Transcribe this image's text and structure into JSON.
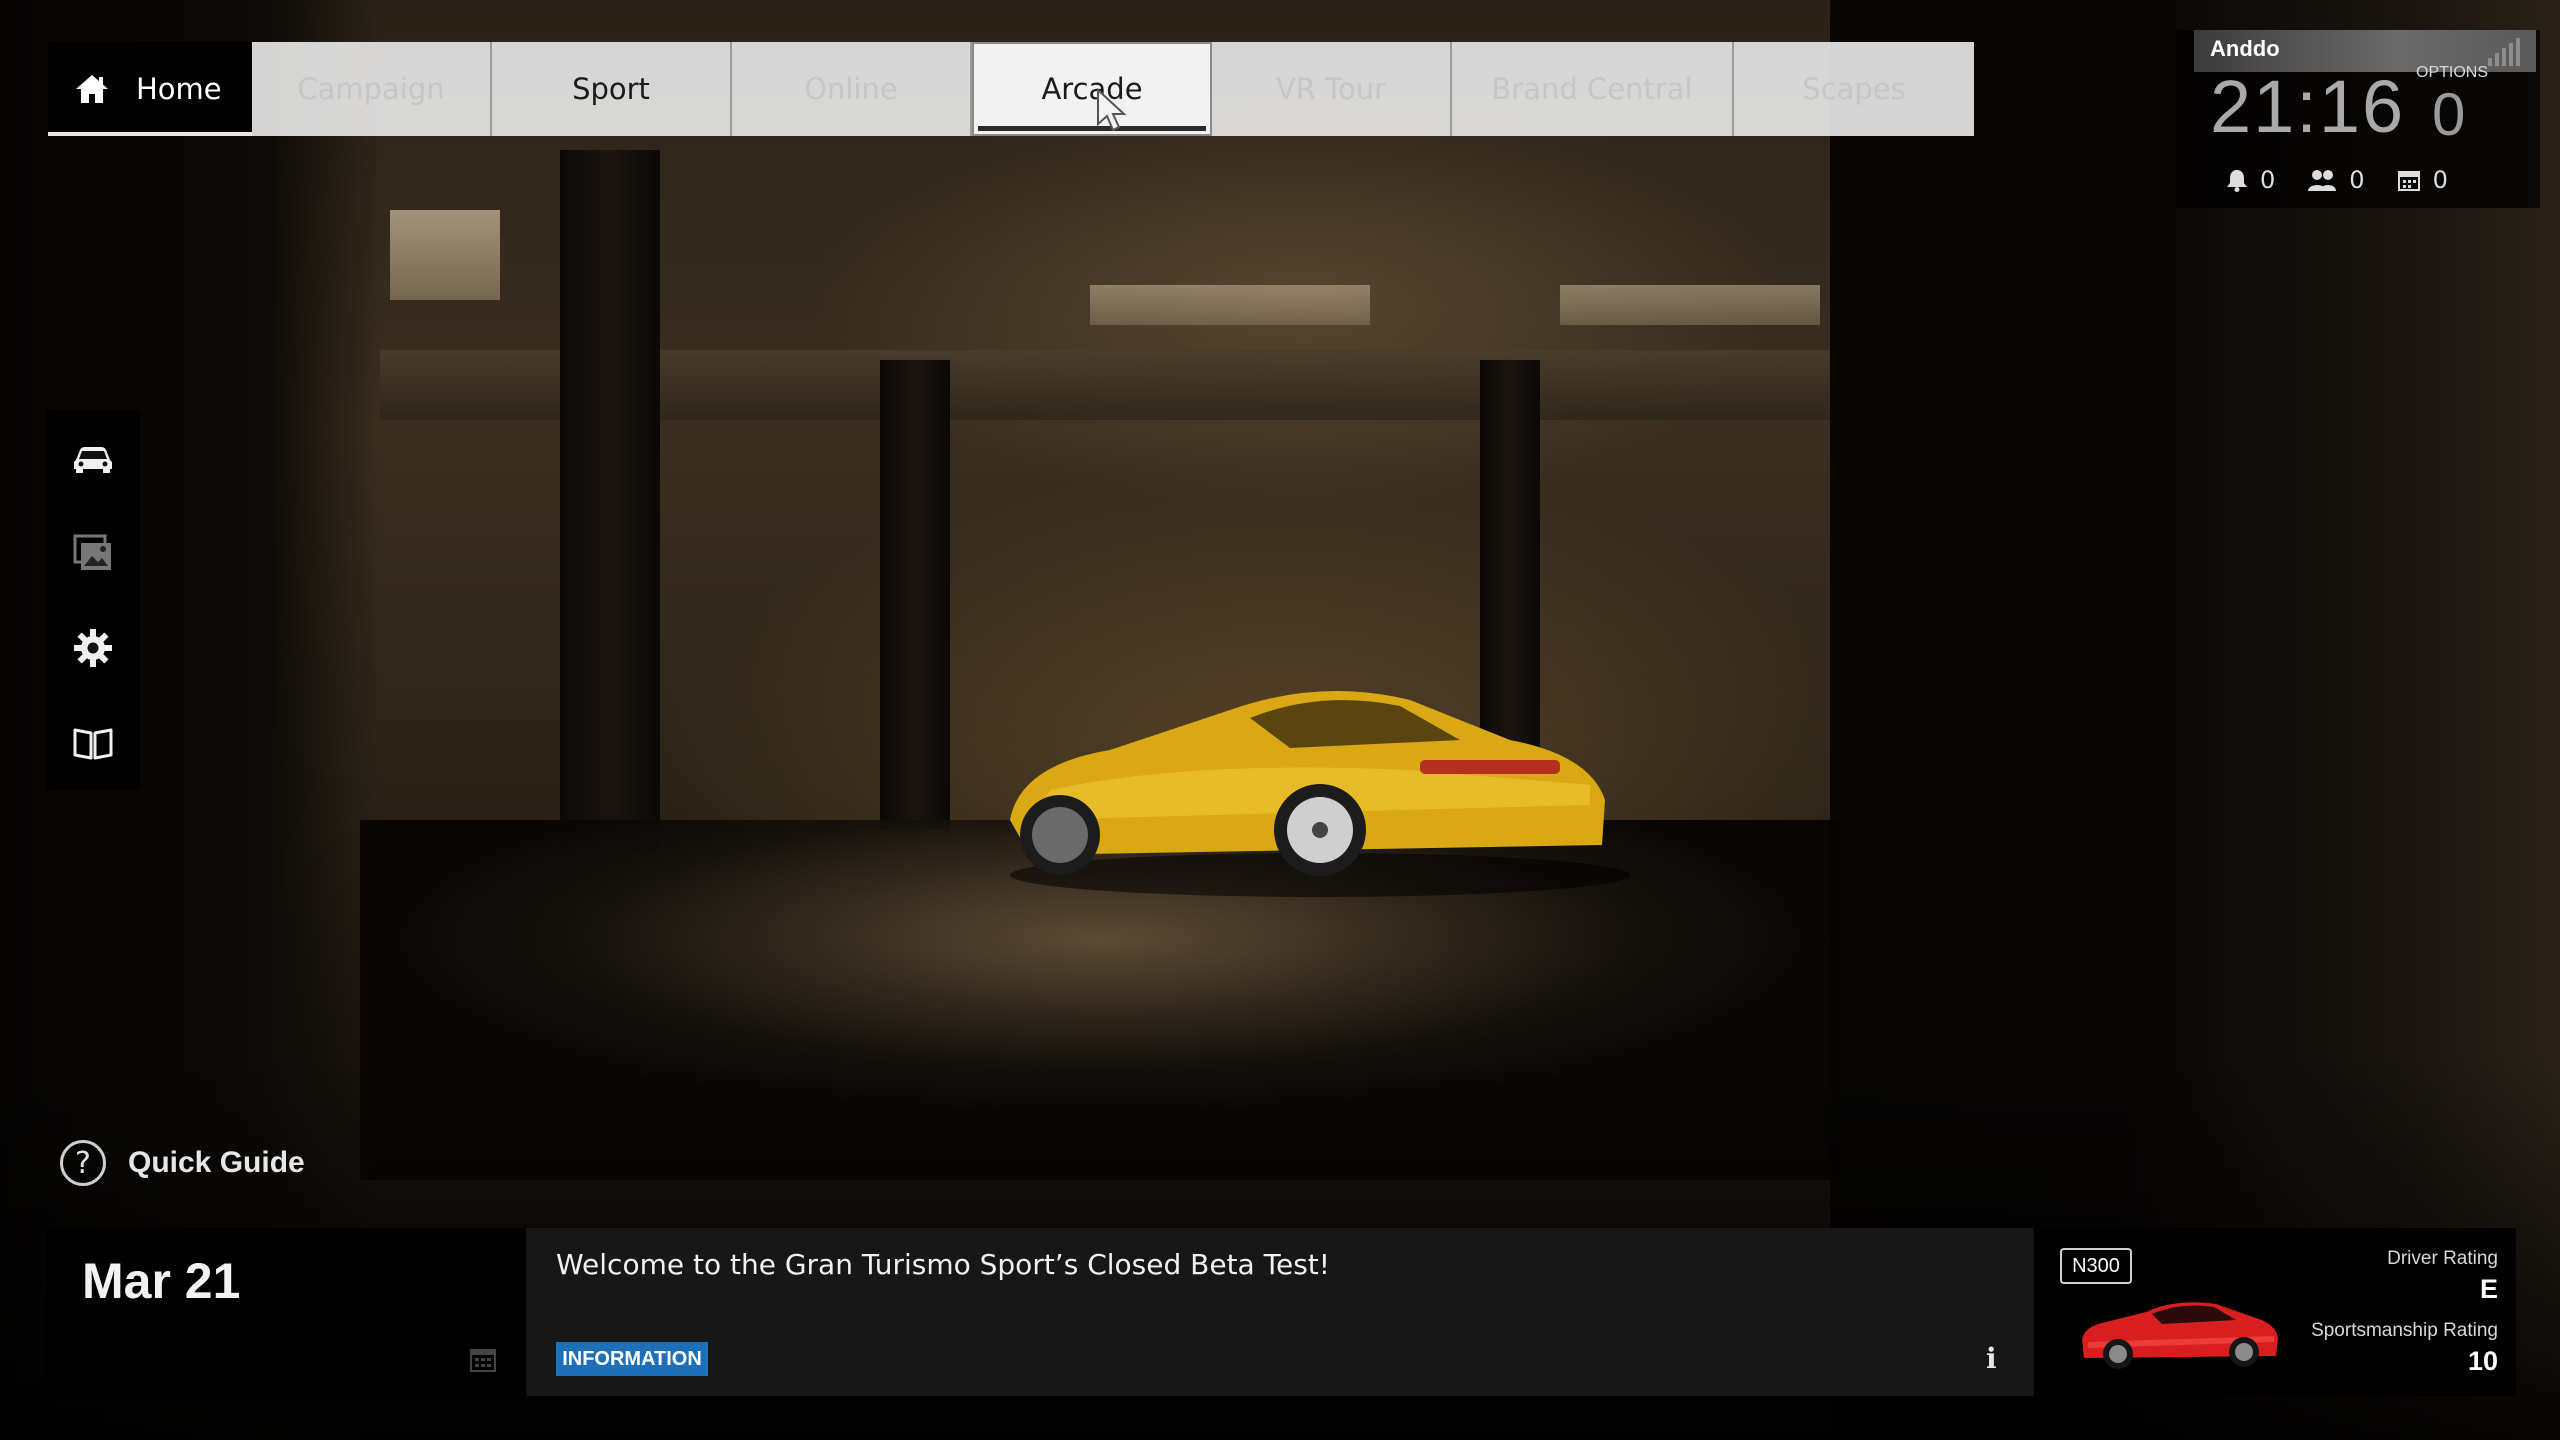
{
  "nav": {
    "tabs": [
      {
        "label": "Home"
      },
      {
        "label": "Campaign"
      },
      {
        "label": "Sport"
      },
      {
        "label": "Online"
      },
      {
        "label": "Arcade"
      },
      {
        "label": "VR Tour"
      },
      {
        "label": "Brand Central"
      },
      {
        "label": "Scapes"
      }
    ],
    "selected": "Arcade"
  },
  "status": {
    "username": "Anddo",
    "clock": "21:16",
    "options_label": "OPTIONS",
    "options_value": "0",
    "notifications_count": "0",
    "friends_count": "0",
    "calendar_count": "0"
  },
  "sidebar": {
    "items": [
      {
        "icon": "car-icon"
      },
      {
        "icon": "gallery-icon"
      },
      {
        "icon": "gear-icon"
      },
      {
        "icon": "book-icon"
      }
    ]
  },
  "quick_guide": {
    "label": "Quick Guide",
    "icon": "question-icon"
  },
  "news": {
    "date": "Mar 21",
    "title": "Welcome to the Gran Turismo Sport’s Closed Beta Test!",
    "badge": "INFORMATION",
    "info_icon": "i"
  },
  "profile": {
    "car_class": "N300",
    "driver_rating_label": "Driver Rating",
    "driver_rating": "E",
    "sportsmanship_label": "Sportsmanship Rating",
    "sportsmanship_rating": "10"
  },
  "colors": {
    "accent_blue": "#1d6fb8",
    "featured_car": "#e0b21a",
    "profile_car": "#d81e1e"
  }
}
